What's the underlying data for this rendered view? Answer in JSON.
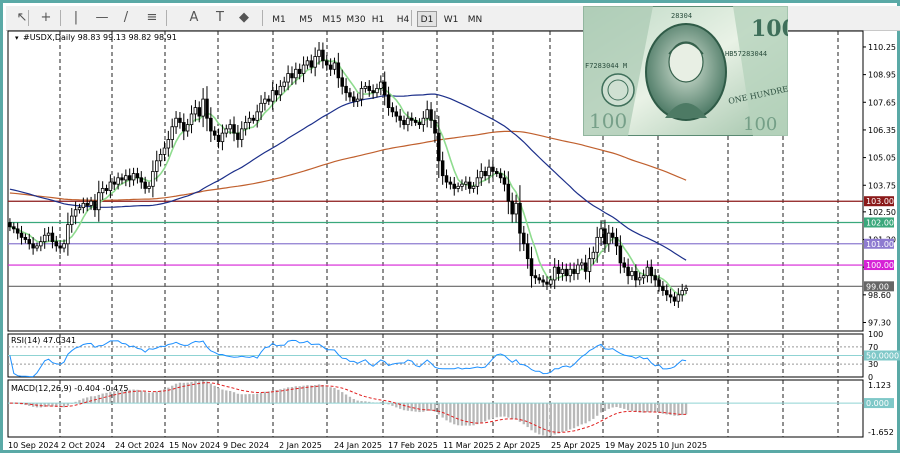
{
  "toolbar": {
    "tools": [
      "cursor-icon",
      "crosshair-icon",
      "vertical-line-icon",
      "horizontal-line-icon",
      "trendline-icon",
      "fibonacci-icon",
      "text-icon",
      "text-label-icon",
      "shapes-icon"
    ],
    "timeframes": [
      "M1",
      "M5",
      "M15",
      "M30",
      "H1",
      "H4",
      "D1",
      "W1",
      "MN"
    ],
    "active_timeframe": "D1"
  },
  "chart_data": [
    {
      "type": "candlestick",
      "symbol": "#USDX,Daily",
      "ohlc_label": "98.83 99.13 98.82 98.91",
      "y_ticks": [
        "110.25",
        "108.95",
        "107.65",
        "106.35",
        "105.05",
        "103.75",
        "102.50",
        "101.20",
        "99.90",
        "98.60",
        "97.30"
      ],
      "ylim": [
        96.9,
        111.0
      ],
      "x_labels": [
        "10 Sep 2024",
        "2 Oct 2024",
        "24 Oct 2024",
        "15 Nov 2024",
        "9 Dec 2024",
        "2 Jan 2025",
        "24 Jan 2025",
        "17 Feb 2025",
        "11 Mar 2025",
        "2 Apr 2025",
        "25 Apr 2025",
        "19 May 2025",
        "10 Jun 2025"
      ],
      "closes": [
        101.8,
        101.7,
        101.5,
        101.3,
        101.2,
        101.0,
        100.8,
        100.9,
        101.1,
        101.4,
        101.5,
        101.1,
        100.9,
        100.8,
        101.0,
        101.9,
        102.3,
        102.6,
        102.7,
        102.9,
        102.8,
        103.0,
        102.6,
        103.4,
        103.6,
        103.5,
        103.9,
        103.8,
        104.1,
        104.0,
        104.2,
        104.0,
        104.3,
        104.1,
        103.9,
        103.6,
        103.7,
        104.4,
        104.9,
        105.2,
        105.5,
        105.9,
        106.5,
        106.9,
        106.7,
        106.3,
        106.6,
        107.1,
        107.4,
        107.0,
        107.8,
        106.9,
        106.3,
        106.1,
        105.8,
        106.2,
        106.4,
        106.6,
        106.2,
        105.9,
        106.4,
        106.7,
        106.9,
        106.8,
        107.2,
        107.6,
        107.8,
        107.7,
        108.2,
        108.0,
        108.4,
        108.6,
        109.0,
        108.8,
        109.2,
        109.0,
        109.4,
        109.6,
        109.3,
        109.8,
        110.1,
        109.6,
        109.4,
        109.2,
        109.5,
        108.8,
        108.4,
        108.1,
        107.9,
        107.7,
        107.8,
        108.3,
        108.4,
        108.2,
        108.1,
        108.3,
        108.6,
        108.0,
        107.4,
        107.2,
        107.0,
        106.8,
        106.6,
        106.9,
        106.8,
        106.7,
        106.6,
        106.9,
        107.3,
        106.8,
        106.2,
        104.9,
        104.2,
        103.9,
        103.8,
        103.6,
        103.7,
        103.8,
        103.9,
        103.6,
        103.7,
        104.1,
        104.4,
        104.2,
        104.6,
        104.4,
        104.3,
        104.1,
        103.8,
        103.0,
        102.4,
        102.9,
        101.5,
        101.0,
        100.3,
        99.5,
        99.4,
        99.3,
        99.2,
        99.1,
        99.3,
        99.9,
        99.6,
        99.8,
        99.5,
        99.8,
        99.6,
        100.0,
        100.1,
        99.7,
        100.3,
        100.6,
        101.3,
        101.7,
        101.0,
        101.5,
        101.3,
        100.9,
        100.1,
        99.9,
        99.5,
        99.7,
        99.3,
        99.4,
        99.5,
        99.9,
        99.5,
        99.3,
        99.0,
        98.8,
        98.6,
        98.5,
        98.3,
        98.6,
        98.8,
        98.91
      ],
      "series": [
        {
          "name": "",
          "color": "#8fdc8f"
        },
        {
          "name": "",
          "color": "#1c2f8a"
        },
        {
          "name": "",
          "color": "#c0602e"
        }
      ],
      "levels": [
        {
          "value": 103.0,
          "label": "103.00",
          "color": "#8b1a1a",
          "text_color": "#ffffff"
        },
        {
          "value": 102.0,
          "label": "102.00",
          "color": "#3aa87c",
          "text_color": "#ffffff"
        },
        {
          "value": 101.0,
          "label": "101.00",
          "color": "#8e7bd0",
          "text_color": "#ffffff"
        },
        {
          "value": 100.0,
          "label": "100.00",
          "color": "#d622d6",
          "text_color": "#ffffff"
        },
        {
          "value": 99.0,
          "label": "99.00",
          "color": "#666666",
          "text_color": "#ffffff"
        }
      ]
    },
    {
      "type": "line",
      "title": "RSI(14) 47.0341",
      "ylim": [
        0,
        100
      ],
      "y_ticks": [
        "100",
        "70",
        "30",
        "0"
      ],
      "level": {
        "label": "50.0000",
        "value": 50
      },
      "color": "#1e90ff"
    },
    {
      "type": "bar",
      "title": "MACD(12,26,9) -0.404 -0.475",
      "ylim": [
        -1.652,
        1.123
      ],
      "y_ticks": [
        "1.123",
        "-1.652"
      ],
      "zero_label": "0.000",
      "histogram_color": "#b8b8b8",
      "signal_color": "#e02020"
    }
  ],
  "photo": {
    "serial_top": "28304",
    "serial_side": "HB57283044",
    "serial_left": "F7283044 M",
    "banner": "ONE HUNDRED"
  }
}
